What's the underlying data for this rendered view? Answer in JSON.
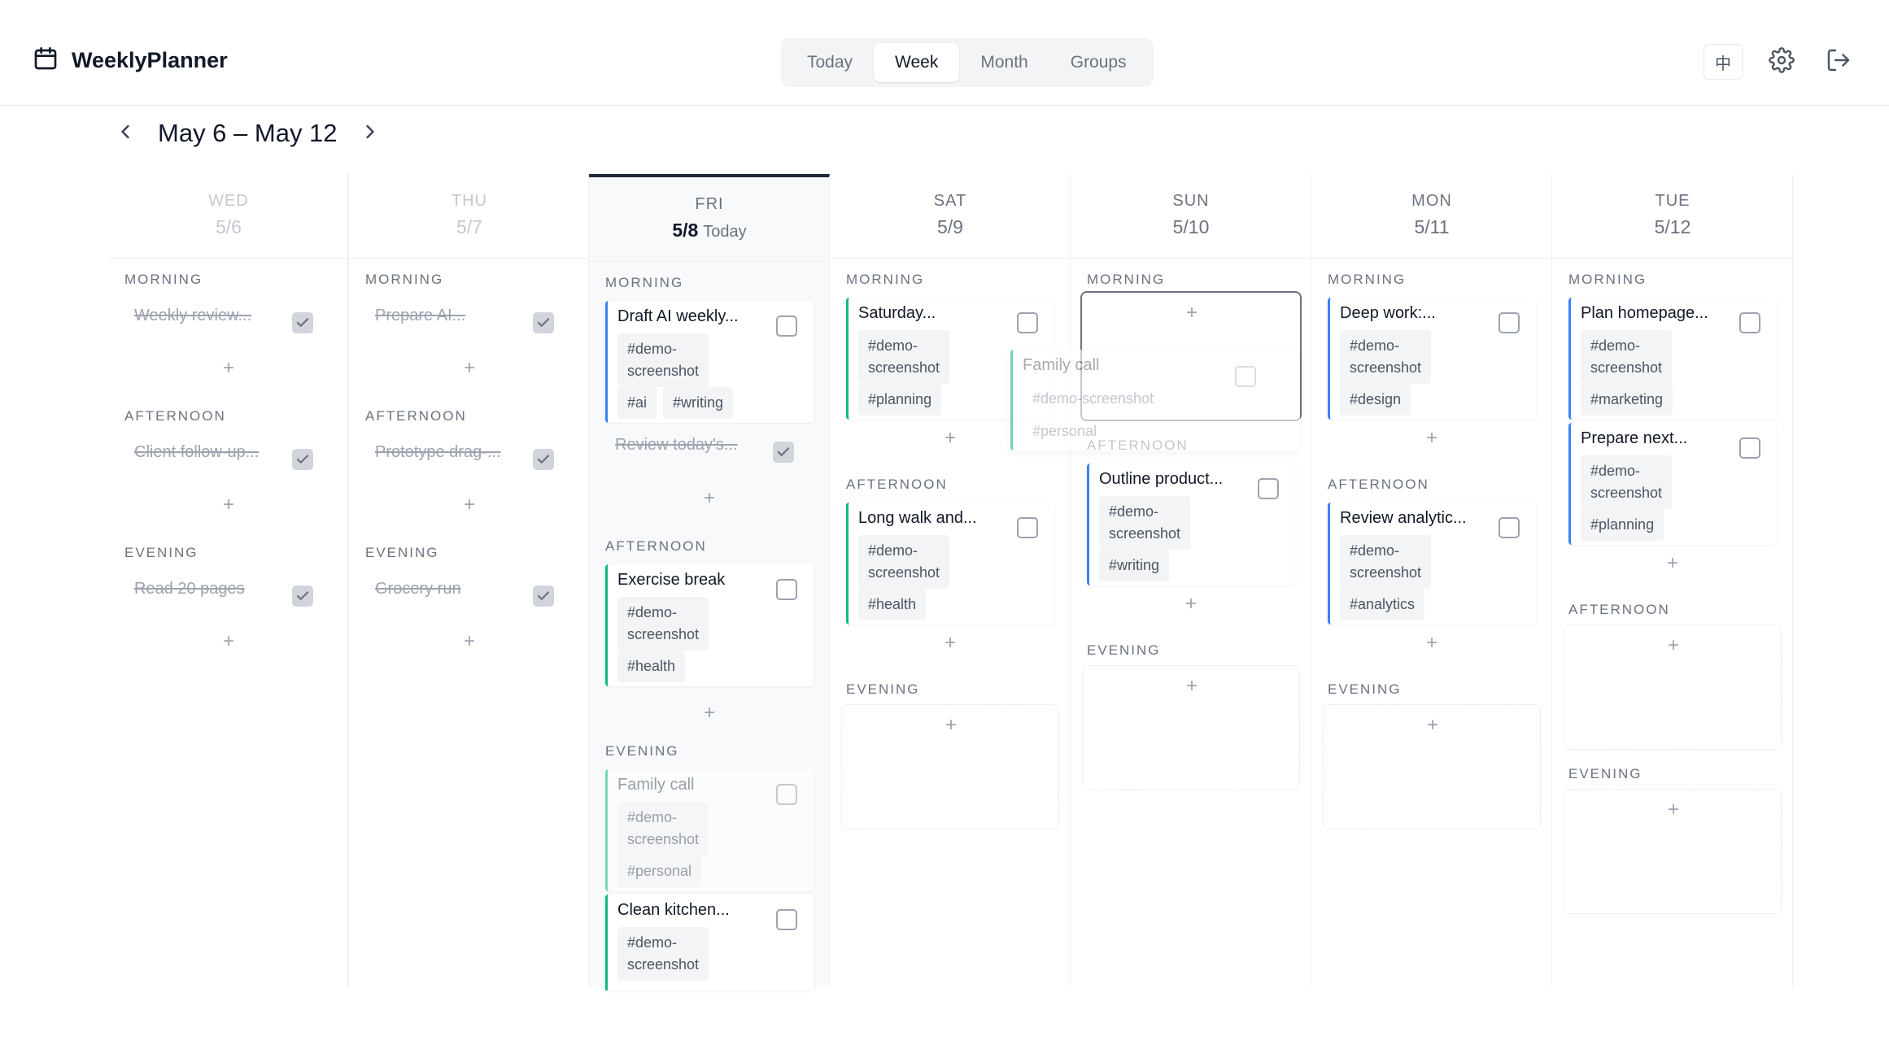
{
  "app": {
    "name": "WeeklyPlanner"
  },
  "tabs": [
    "Today",
    "Week",
    "Month",
    "Groups"
  ],
  "active_tab": "Week",
  "header_icons": {
    "lang_label": "中",
    "settings": "gear-icon",
    "logout": "logout-icon",
    "brand": "calendar-icon"
  },
  "week": {
    "range": "May 6 – May 12"
  },
  "sections": {
    "morning": "MORNING",
    "afternoon": "AFTERNOON",
    "evening": "EVENING"
  },
  "plus": "+",
  "days": [
    {
      "dow": "WED",
      "date": "5/6"
    },
    {
      "dow": "THU",
      "date": "5/7"
    },
    {
      "dow": "FRI",
      "date": "5/8",
      "today_label": "Today"
    },
    {
      "dow": "SAT",
      "date": "5/9"
    },
    {
      "dow": "SUN",
      "date": "5/10"
    },
    {
      "dow": "MON",
      "date": "5/11"
    },
    {
      "dow": "TUE",
      "date": "5/12"
    }
  ],
  "tasks": {
    "wed_m": "Weekly review...",
    "wed_a": "Client follow-up...",
    "wed_e": "Read 20 pages",
    "thu_m": "Prepare AI...",
    "thu_a": "Prototype drag-...",
    "thu_e": "Grocery run",
    "fri_m1": {
      "title": "Draft AI weekly...",
      "tags": [
        "#demo-screenshot",
        "#ai",
        "#writing"
      ]
    },
    "fri_m2": "Review today's...",
    "fri_a1": {
      "title": "Exercise break",
      "tags": [
        "#demo-screenshot",
        "#health"
      ]
    },
    "fri_e1": {
      "title": "Family call",
      "tags": [
        "#demo-screenshot",
        "#personal"
      ]
    },
    "fri_e2": {
      "title": "Clean kitchen...",
      "tags": [
        "#demo-screenshot"
      ]
    },
    "sat_m1": {
      "title": "Saturday...",
      "tags": [
        "#demo-screenshot",
        "#planning"
      ]
    },
    "sat_a1": {
      "title": "Long walk and...",
      "tags": [
        "#demo-screenshot",
        "#health"
      ]
    },
    "sun_drag": {
      "title": "Family call",
      "tags": [
        "#demo-screenshot",
        "#personal"
      ]
    },
    "sun_a1": {
      "title": "Outline product...",
      "tags": [
        "#demo-screenshot",
        "#writing"
      ]
    },
    "mon_m1": {
      "title": "Deep work:...",
      "tags": [
        "#demo-screenshot",
        "#design"
      ]
    },
    "mon_a1": {
      "title": "Review analytic...",
      "tags": [
        "#demo-screenshot",
        "#analytics"
      ]
    },
    "tue_m1": {
      "title": "Plan homepage...",
      "tags": [
        "#demo-screenshot",
        "#marketing"
      ]
    },
    "tue_m2": {
      "title": "Prepare next...",
      "tags": [
        "#demo-screenshot",
        "#planning"
      ]
    }
  },
  "tag_split": {
    "first": "#demo-",
    "second": "screenshot"
  }
}
